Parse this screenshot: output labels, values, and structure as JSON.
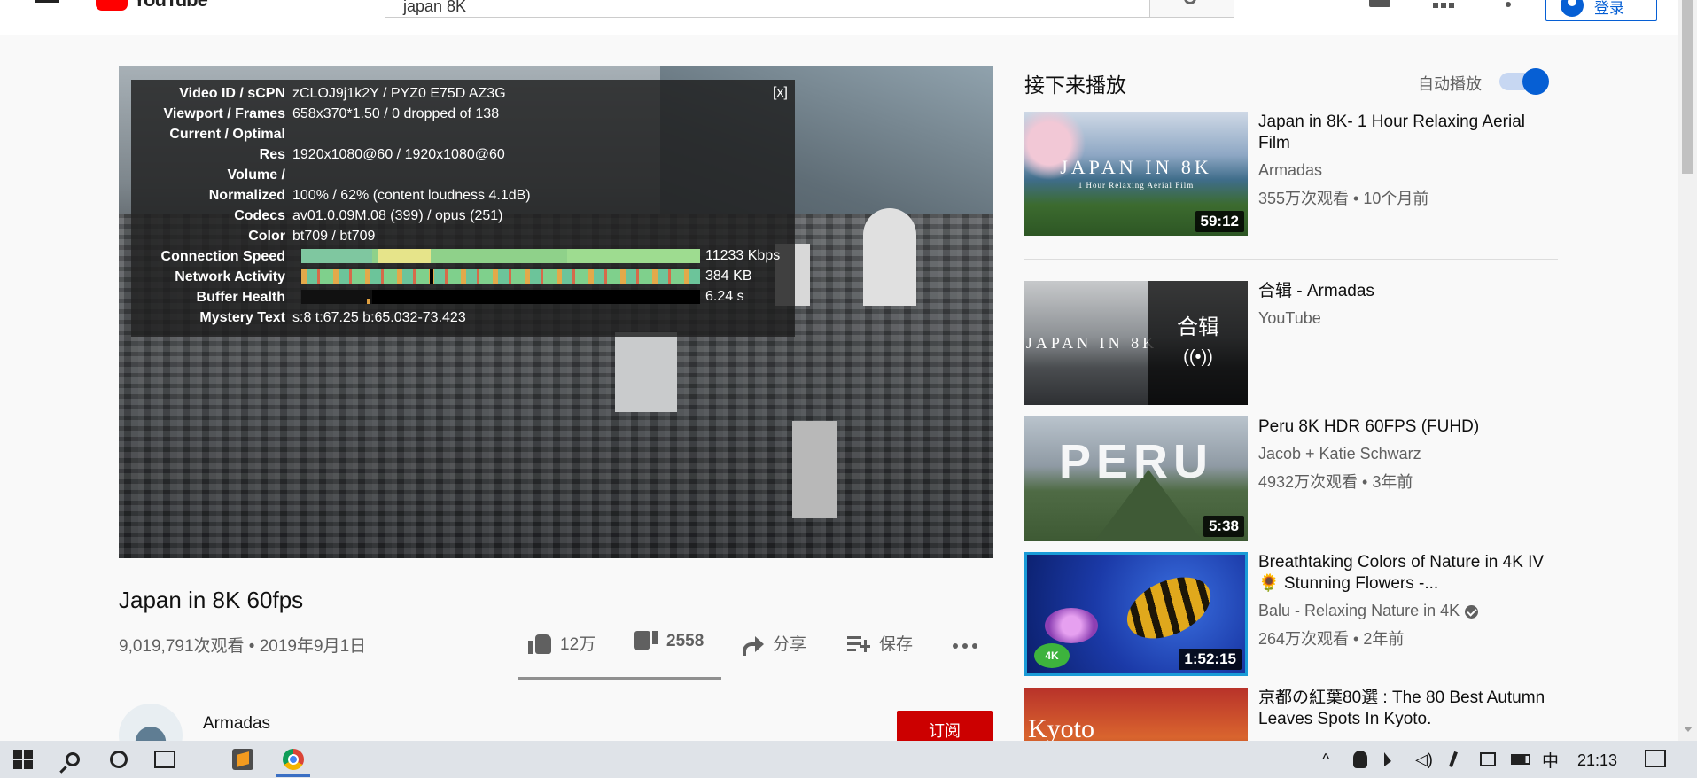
{
  "header": {
    "logo_text": "YouTube",
    "search_query": "japan 8K",
    "signin_label": "登录"
  },
  "player": {
    "stats": [
      {
        "label": "Video ID / sCPN",
        "value": "zCLOJ9j1k2Y / PYZ0 E75D AZ3G"
      },
      {
        "label": "Viewport / Frames",
        "value": "658x370*1.50 / 0 dropped of 138"
      },
      {
        "label": "Current / Optimal",
        "value": ""
      },
      {
        "label": "Res",
        "value": "1920x1080@60 / 1920x1080@60"
      },
      {
        "label": "Volume /",
        "value": ""
      },
      {
        "label": "Normalized",
        "value": "100% / 62% (content loudness 4.1dB)"
      },
      {
        "label": "Codecs",
        "value": "av01.0.09M.08 (399) / opus (251)"
      },
      {
        "label": "Color",
        "value": "bt709 / bt709"
      },
      {
        "label": "Connection Speed",
        "value": "11233 Kbps"
      },
      {
        "label": "Network Activity",
        "value": "384 KB"
      },
      {
        "label": "Buffer Health",
        "value": "6.24 s"
      },
      {
        "label": "Mystery Text",
        "value": "s:8 t:67.25 b:65.032-73.423"
      }
    ],
    "close_label": "[x]"
  },
  "video": {
    "title": "Japan in 8K 60fps",
    "meta": "9,019,791次观看 • 2019年9月1日",
    "likes": "12万",
    "dislikes": "2558",
    "share_label": "分享",
    "save_label": "保存",
    "channel_name": "Armadas",
    "subscribe_label": "订阅"
  },
  "sidebar": {
    "up_next": "接下来播放",
    "autoplay_label": "自动播放",
    "autoplay_on": true,
    "recs": [
      {
        "title": "Japan in 8K- 1 Hour Relaxing Aerial Film",
        "channel": "Armadas",
        "views": "355万次观看 • 10个月前",
        "duration": "59:12",
        "thumb_text": "JAPAN IN 8K",
        "thumb_sub": "1 Hour Relaxing Aerial Film"
      },
      {
        "title": "合辑 - Armadas",
        "channel": "YouTube",
        "views": "",
        "duration": "",
        "thumb_text": "JAPAN IN 8K",
        "mix_label": "合辑",
        "mix_icon": "((•))"
      },
      {
        "title": "Peru 8K HDR 60FPS (FUHD)",
        "channel": "Jacob + Katie Schwarz",
        "views": "4932万次观看 • 3年前",
        "duration": "5:38",
        "thumb_text": "PERU"
      },
      {
        "title": "Breathtaking Colors of Nature in 4K IV 🌻 Stunning Flowers -...",
        "channel": "Balu - Relaxing Nature in 4K",
        "views": "264万次观看 • 2年前",
        "duration": "1:52:15",
        "badge": "4K"
      },
      {
        "title": "京都の紅葉80選 : The 80 Best Autumn Leaves Spots In Kyoto.",
        "channel": "",
        "views": "",
        "duration": "",
        "thumb_text": "Kyoto"
      }
    ]
  },
  "taskbar": {
    "time": "21:13",
    "ime": "中"
  },
  "colors": {
    "accent": "#065fd4",
    "subscribe": "#cc0000",
    "youtube_red": "#ff0000"
  }
}
